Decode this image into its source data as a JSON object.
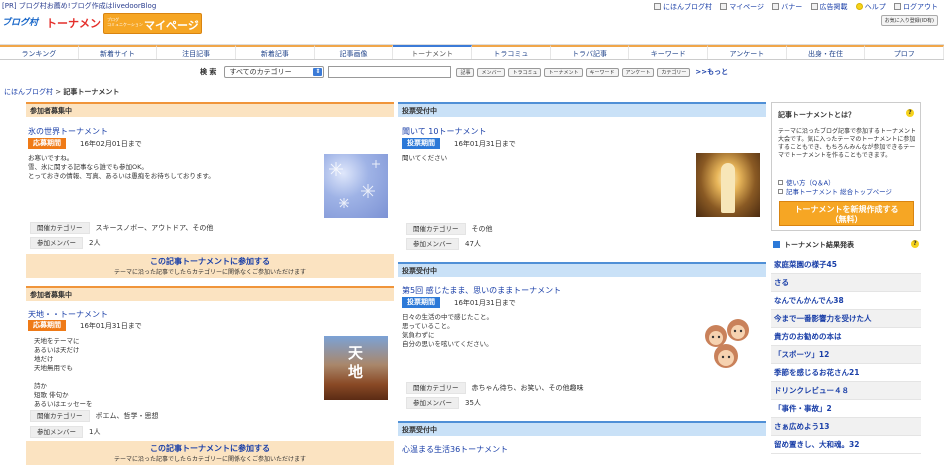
{
  "header": {
    "pr_text": "[PR] ブログ村お薦め!ブログ作成はlivedoorBlog",
    "logo_blog": "ブログ村",
    "logo_tournament": "トーナメント",
    "logo_mypage_small": "ブログ\nコミュニケーション",
    "logo_mypage": "マイページ",
    "top_links": [
      "にほんブログ村",
      "マイページ",
      "バナー",
      "広告掲載",
      "ヘルプ",
      "ログアウト"
    ],
    "fav_button": "お気に入り登録(ID有)"
  },
  "nav": {
    "items": [
      "ランキング",
      "新着サイト",
      "注目記事",
      "新着記事",
      "記事画像",
      "トーナメント",
      "トラコミュ",
      "トラバ記事",
      "キーワード",
      "アンケート",
      "出身・在住",
      "プロフ"
    ],
    "active_index": 5
  },
  "search": {
    "label": "検 索",
    "category": "すべてのカテゴリー",
    "chips": [
      "記事",
      "メンバー",
      "トラコミュ",
      "トーナメント",
      "キーワード",
      "アンケート",
      "カテゴリー"
    ],
    "more": ">>もっと"
  },
  "breadcrumb": {
    "home": "にほんブログ村",
    "sep": ">",
    "current": "記事トーナメント"
  },
  "labels": {
    "apply_period": "応募期間",
    "vote_period": "投票期間",
    "category": "開催カテゴリー",
    "members": "参加メンバー",
    "join": "この記事トーナメントに参加する",
    "join_sub": "テーマに沿った記事でしたらカテゴリーに関係なくご参加いただけます"
  },
  "left": [
    {
      "header": "参加者募集中",
      "title": "氷の世界トーナメント",
      "date": "16年02月01日まで",
      "desc": "お寒いですね。\n雪、氷に関する記事なら誰でも参加OK。\nとっておきの情報、写真、あるいは愚痴をお待ちしております。",
      "category": "スキースノボー、アウトドア、その他",
      "members": "2人"
    },
    {
      "header": "参加者募集中",
      "title": "天地・・トーナメント",
      "date": "16年01月31日まで",
      "desc": "天地をテーマに\nあるいは天だけ\n地だけ\n天地無用でも\n\n詩か\n短歌 俳句か\nあるいはエッセーを",
      "category": "ポエム、哲学・思想",
      "members": "1人",
      "thumb_text": "天\n地"
    }
  ],
  "middle": [
    {
      "header": "投票受付中",
      "title": "聞いて 10トーナメント",
      "date": "16年01月31日まで",
      "desc": "聞いてください",
      "category": "その他",
      "members": "47人"
    },
    {
      "header": "投票受付中",
      "title": "第5回 感じたまま、思いのままトーナメント",
      "date": "16年01月31日まで",
      "desc": "日々の生活の中で感じたこと。\n思っていること。\n気負わずに\n自分の思いを呟いてください。",
      "category": "赤ちゃん待ち、お笑い、その他趣味",
      "members": "35人"
    },
    {
      "header": "投票受付中",
      "title": "心温まる生活36トーナメント"
    }
  ],
  "sidebar": {
    "box_title": "記事トーナメントとは？",
    "box_desc": "テーマに沿ったブログ記事で参加するトーナメント大会です。気に入ったテーマのトーナメントに参加することもでき、もちろんみんなが参加できるテーマでトーナメントを作ることもできます。",
    "link1": "使い方（Q＆A）",
    "link2": "記事トーナメント 総合トップページ",
    "create_button": "トーナメントを新規作成する\n（無料）",
    "results_title": "トーナメント結果発表",
    "results": [
      "家庭菜園の様子45",
      "さる",
      "なんでんかんでん38",
      "今まで一番影響力を受けた人",
      "貴方のお勧めの本は",
      "「スポーツ」12",
      "季節を感じるお花さん21",
      "ドリンクレビュー４８",
      "「事件・事故」2",
      "さぁ広めよう13",
      "留め置きし、大和魂。32"
    ]
  },
  "colors": {
    "link": "#1a3fa8",
    "orange": "#ef7a17",
    "blue": "#2c79d8",
    "header_orange_bg": "#fbe3c1",
    "header_blue_bg": "#c9e1f7"
  }
}
